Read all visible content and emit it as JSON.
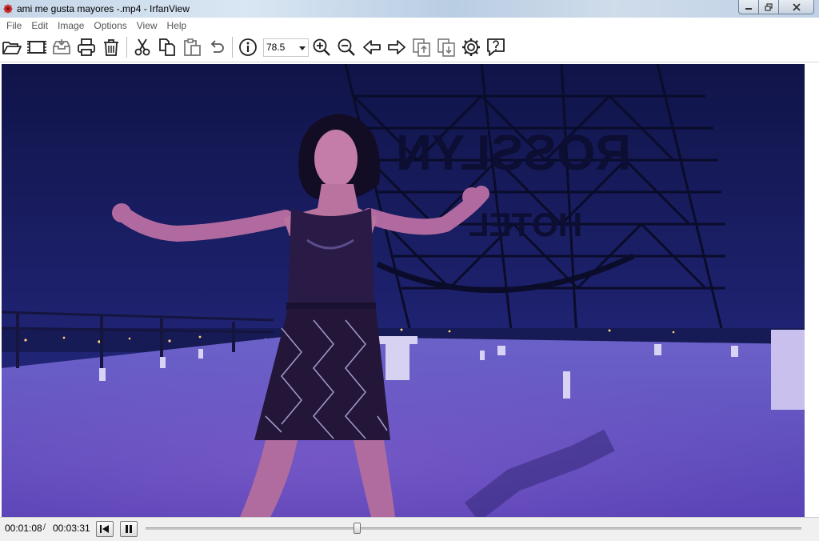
{
  "window": {
    "title": "ami me gusta mayores -.mp4 - IrfanView"
  },
  "menu": {
    "items": [
      "File",
      "Edit",
      "Image",
      "Options",
      "View",
      "Help"
    ]
  },
  "toolbar": {
    "zoom_value": "78.5",
    "icons": [
      "open-folder-icon",
      "filmstrip-icon",
      "save-icon",
      "print-icon",
      "trash-icon",
      "cut-icon",
      "copy-icon",
      "paste-icon",
      "undo-icon",
      "info-icon",
      "zoom-in-icon",
      "zoom-out-icon",
      "arrow-left-icon",
      "arrow-right-icon",
      "page-up-icon",
      "page-down-icon",
      "gear-icon",
      "help-icon"
    ]
  },
  "video": {
    "sign_text_top": "ROSSLYN",
    "sign_text_bottom": "HOTEL"
  },
  "player": {
    "current_time": "00:01:08",
    "separator": "/",
    "total_time": "00:03:31",
    "progress": 0.322
  },
  "colors": {
    "sky": "#1b1d66",
    "rooftop": "#6b58c8",
    "accent": "#2a6fd0"
  }
}
